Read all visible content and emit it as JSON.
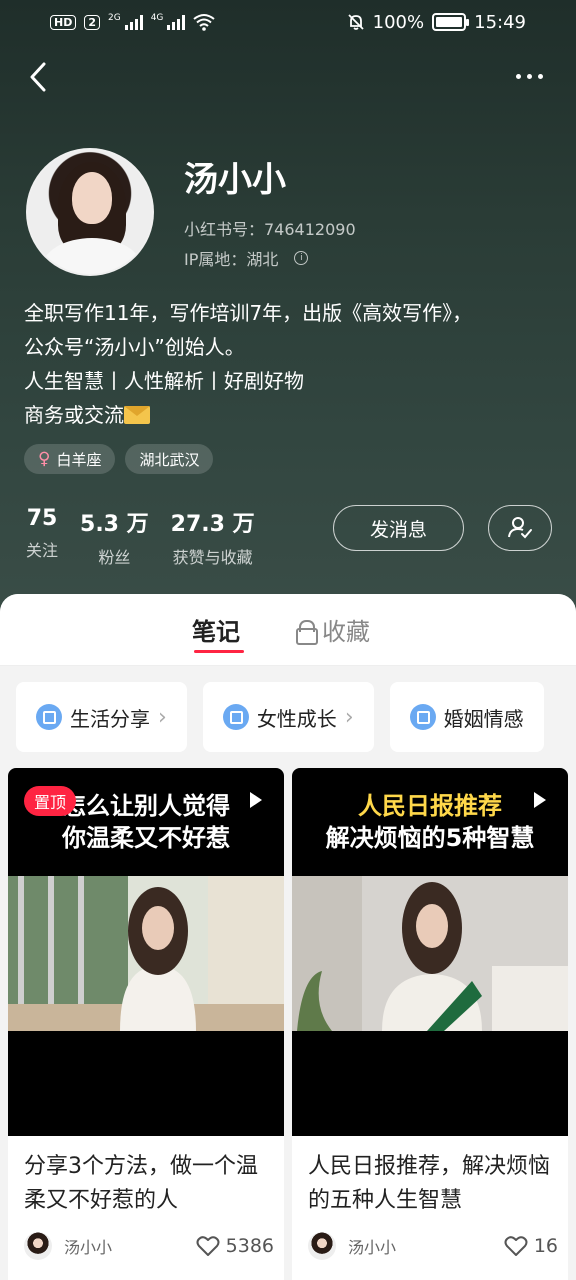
{
  "statusbar": {
    "hd": "HD",
    "sim": "2",
    "net1": "2G",
    "net2": "4G",
    "battery": "100%",
    "time": "15:49",
    "battery_level": 1.0
  },
  "profile": {
    "name": "汤小小",
    "red_id": "小红书号：746412090",
    "ip": "IP属地：湖北",
    "bio": [
      "全职写作11年，写作培训7年，出版《高效写作》，",
      "公众号“汤小小”创始人。",
      "人生智慧丨人性解析丨好剧好物",
      "商务或交流"
    ],
    "tags": [
      "白羊座",
      "湖北武汉"
    ],
    "stats": [
      {
        "value": "75",
        "label": "关注"
      },
      {
        "value": "5.3 万",
        "label": "粉丝"
      },
      {
        "value": "27.3 万",
        "label": "获赞与收藏"
      }
    ],
    "message_button": "发消息"
  },
  "tabs": {
    "notes": "笔记",
    "favorites": "收藏"
  },
  "collections": [
    {
      "label": "生活分享"
    },
    {
      "label": "女性成长"
    },
    {
      "label": "婚姻情感"
    }
  ],
  "cards": [
    {
      "pin": "置顶",
      "thumb_line1": "怎么让别人觉得",
      "thumb_line2": "你温柔又不好惹",
      "title": "分享3个方法，做一个温柔又不好惹的人",
      "author": "汤小小",
      "likes": "5386"
    },
    {
      "thumb_line1": "人民日报推荐",
      "thumb_line2": "解决烦恼的5种智慧",
      "title": "人民日报推荐，解决烦恼的五种人生智慧",
      "author": "汤小小",
      "likes": "16"
    }
  ],
  "colors": {
    "accent": "#ff2442",
    "header_bg": "#2a3c36",
    "collection_icon": "#6aa9f2"
  }
}
